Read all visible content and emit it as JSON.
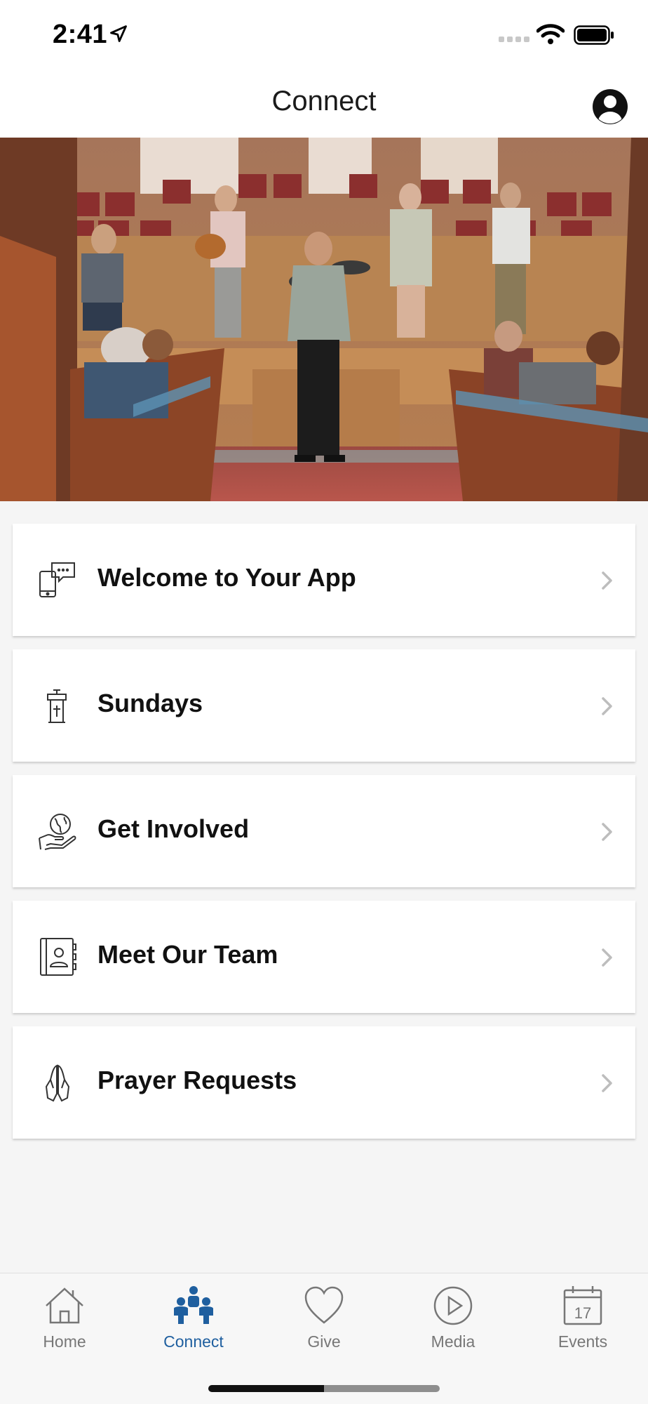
{
  "status_bar": {
    "time": "2:41"
  },
  "header": {
    "title": "Connect"
  },
  "menu": {
    "items": [
      {
        "label": "Welcome to Your App",
        "icon": "phone-chat-icon"
      },
      {
        "label": "Sundays",
        "icon": "pulpit-icon"
      },
      {
        "label": "Get Involved",
        "icon": "globe-hand-icon"
      },
      {
        "label": "Meet Our Team",
        "icon": "directory-book-icon"
      },
      {
        "label": "Prayer Requests",
        "icon": "praying-hands-icon"
      }
    ]
  },
  "tabbar": {
    "tabs": [
      {
        "label": "Home",
        "icon": "house-icon",
        "active": false
      },
      {
        "label": "Connect",
        "icon": "people-icon",
        "active": true
      },
      {
        "label": "Give",
        "icon": "heart-icon",
        "active": false
      },
      {
        "label": "Media",
        "icon": "play-icon",
        "active": false
      },
      {
        "label": "Events",
        "icon": "calendar-icon",
        "active": false,
        "calendar_day": "17"
      }
    ]
  },
  "colors": {
    "accent": "#1f5f9f",
    "tab_inactive": "#777777",
    "background": "#f5f5f5"
  }
}
